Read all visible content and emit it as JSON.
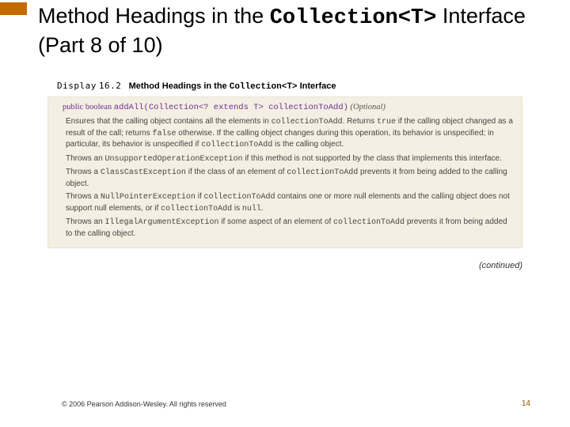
{
  "title": {
    "pre": "Method Headings in the ",
    "code": "Collection<T>",
    "post": " Interface (Part 8 of 10)"
  },
  "display": {
    "label_prefix": "Display",
    "number": "16.2",
    "label_text": "Method Headings in the ",
    "label_code": "Collection<T>",
    "label_suffix": " Interface"
  },
  "signature": {
    "kw1": "public",
    "kw2": "boolean",
    "name": "addAll(Collection<? extends T> collectionToAdd)",
    "optional": "(Optional)"
  },
  "paras": {
    "p1a": "Ensures that the calling object contains all the elements in ",
    "p1code1": "collectionToAdd",
    "p1b": ". Returns ",
    "p1code2": "true",
    "p1c": " if the calling object changed as a result of the call; returns ",
    "p1code3": "false",
    "p1d": " otherwise. If the calling object changes during this operation, its behavior is unspecified; in particular, its behavior is unspecified if ",
    "p1code4": "collectionToAdd",
    "p1e": " is the calling object.",
    "p2a": "Throws an ",
    "p2code1": "UnsupportedOperationException",
    "p2b": " if this method is not supported by the class that implements this interface.",
    "p3a": "Throws a ",
    "p3code1": "ClassCastException",
    "p3b": " if the class of an element of ",
    "p3code2": "collectionToAdd",
    "p3c": " prevents it from being added to the calling object.",
    "p4a": "Throws a ",
    "p4code1": "NullPointerException",
    "p4b": " if ",
    "p4code2": "collectionToAdd",
    "p4c": " contains one or more null elements and the calling object does not support null elements, or if ",
    "p4code3": "collectionToAdd",
    "p4d": " is ",
    "p4code4": "null",
    "p4e": ".",
    "p5a": "Throws an ",
    "p5code1": "IllegalArgumentException",
    "p5b": " if some aspect of an element of ",
    "p5code2": "collectionToAdd",
    "p5c": " prevents it from being added to the calling object."
  },
  "continued": "(continued)",
  "footer": {
    "copyright": "© 2006 Pearson Addison-Wesley. All rights reserved",
    "page": "14"
  }
}
